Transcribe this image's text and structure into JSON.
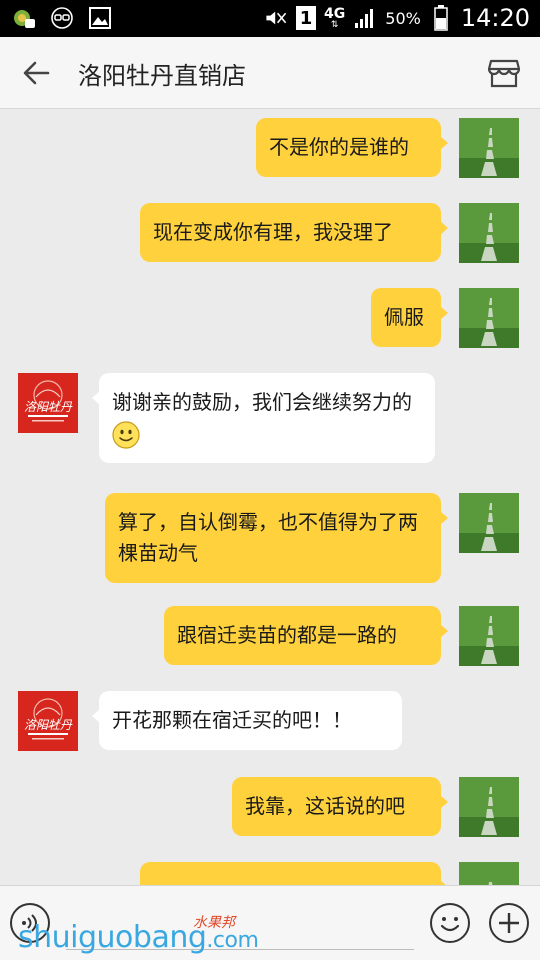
{
  "status_bar": {
    "battery_text": "50%",
    "time": "14:20",
    "sim_slot": "1",
    "network": "4G",
    "icons": [
      "game-notification-icon",
      "vr-glasses-icon",
      "image-icon",
      "mute-icon",
      "signal-icon",
      "battery-icon"
    ]
  },
  "header": {
    "title": "洛阳牡丹直销店",
    "back_icon": "arrow-left-icon",
    "shop_icon": "store-icon"
  },
  "messages": [
    {
      "side": "out",
      "text": "不是你的是谁的"
    },
    {
      "side": "out",
      "text": "现在变成你有理，我没理了"
    },
    {
      "side": "out",
      "text": "佩服"
    },
    {
      "side": "in",
      "text": "谢谢亲的鼓励，我们会继续努力的",
      "emoji": "smile-emoji"
    },
    {
      "side": "out",
      "text": "算了，自认倒霉，也不值得为了两棵苗动气"
    },
    {
      "side": "out",
      "text": "跟宿迁卖苗的都是一路的"
    },
    {
      "side": "in",
      "text": "开花那颗在宿迁买的吧！！"
    },
    {
      "side": "out",
      "text": "我靠，这话说的吧"
    }
  ],
  "input_bar": {
    "voice_icon": "voice-icon",
    "emoji_icon": "emoji-icon",
    "plus_icon": "plus-icon"
  },
  "watermark": {
    "text": "shuiguobang",
    "suffix": ".com",
    "cn": "水果邦"
  },
  "colors": {
    "out_bubble": "#ffd13d",
    "in_bubble": "#ffffff",
    "background": "#ebebeb",
    "brand_red": "#d7261e"
  }
}
